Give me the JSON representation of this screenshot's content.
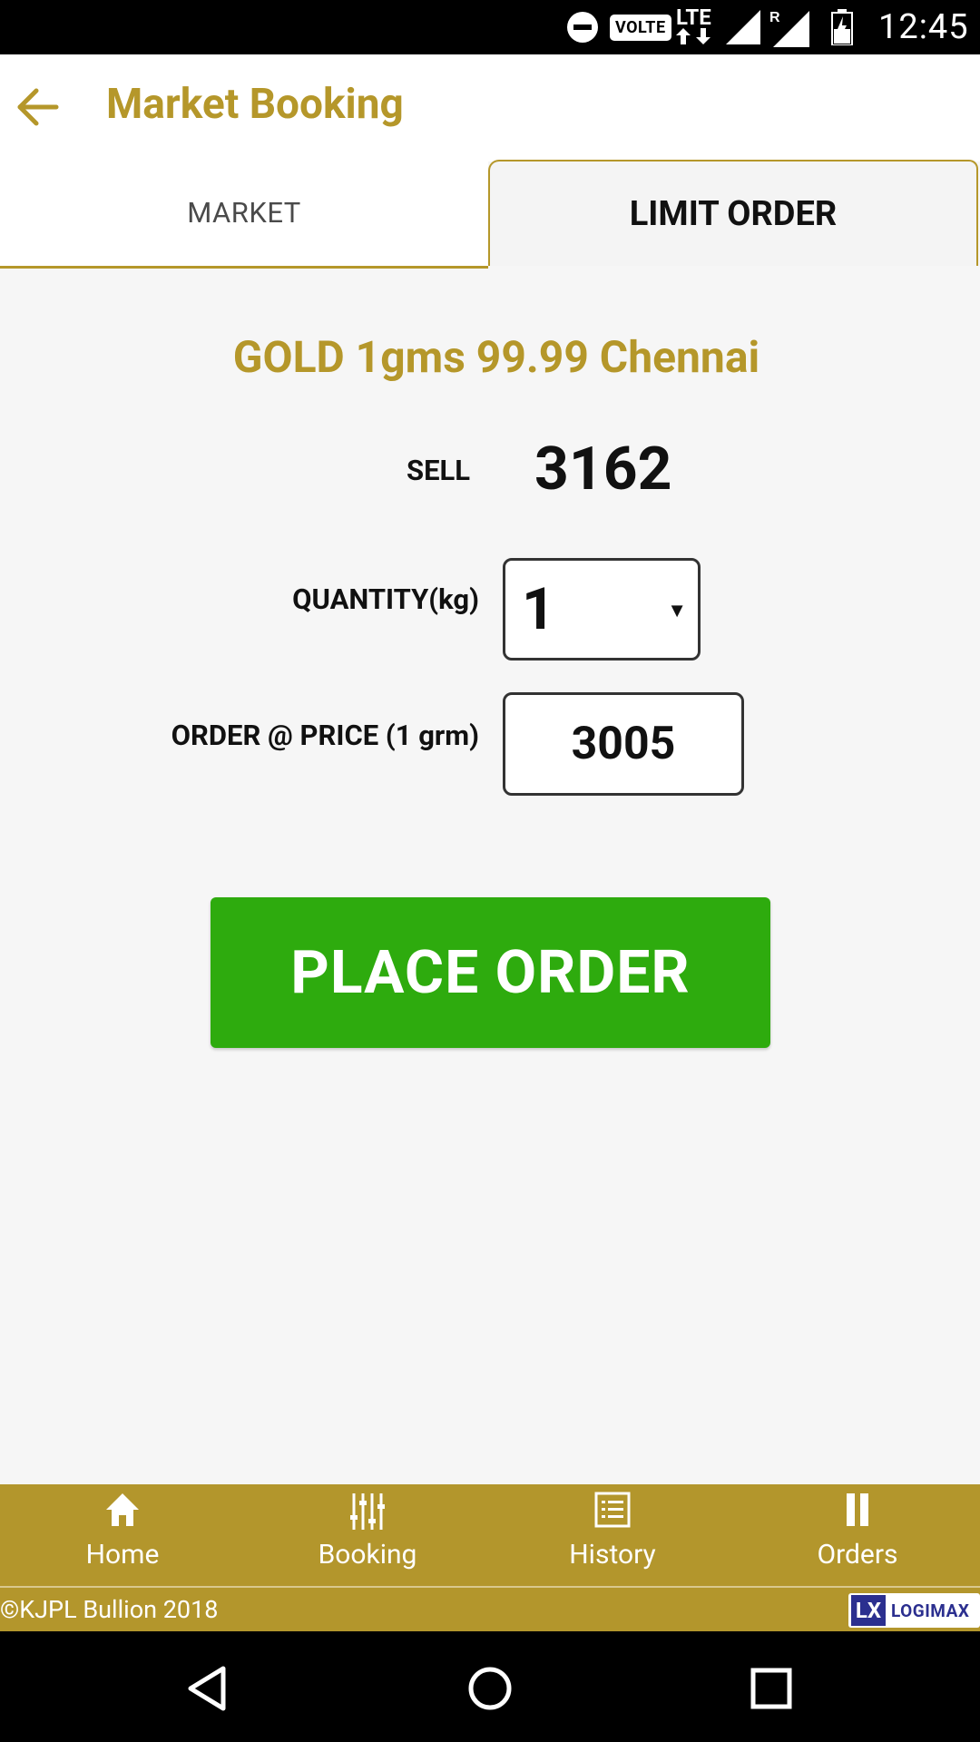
{
  "status_bar": {
    "time": "12:45",
    "volte": "VOLTE",
    "network": "LTE",
    "roaming": "R"
  },
  "app_bar": {
    "title": "Market Booking"
  },
  "tabs": [
    {
      "label": "MARKET",
      "selected": false
    },
    {
      "label": "LIMIT ORDER",
      "selected": true
    }
  ],
  "product": {
    "name": "GOLD 1gms 99.99 Chennai",
    "sell_label": "SELL",
    "sell_value": "3162"
  },
  "form": {
    "quantity_label": "QUANTITY(kg)",
    "quantity_value": "1",
    "price_label": "ORDER @ PRICE (1 grm)",
    "price_value": "3005"
  },
  "actions": {
    "place_order_label": "PLACE ORDER"
  },
  "bottom_nav": [
    {
      "label": "Home",
      "icon": "home-icon"
    },
    {
      "label": "Booking",
      "icon": "sliders-icon"
    },
    {
      "label": "History",
      "icon": "list-icon"
    },
    {
      "label": "Orders",
      "icon": "pause-icon"
    }
  ],
  "footer": {
    "copyright": "©KJPL Bullion 2018",
    "logo_mark": "LX",
    "logo_text": "LOGIMAX"
  },
  "colors": {
    "brand_gold": "#b5972a",
    "nav_gold": "#b3962c",
    "place_order_green": "#2eab0e"
  }
}
